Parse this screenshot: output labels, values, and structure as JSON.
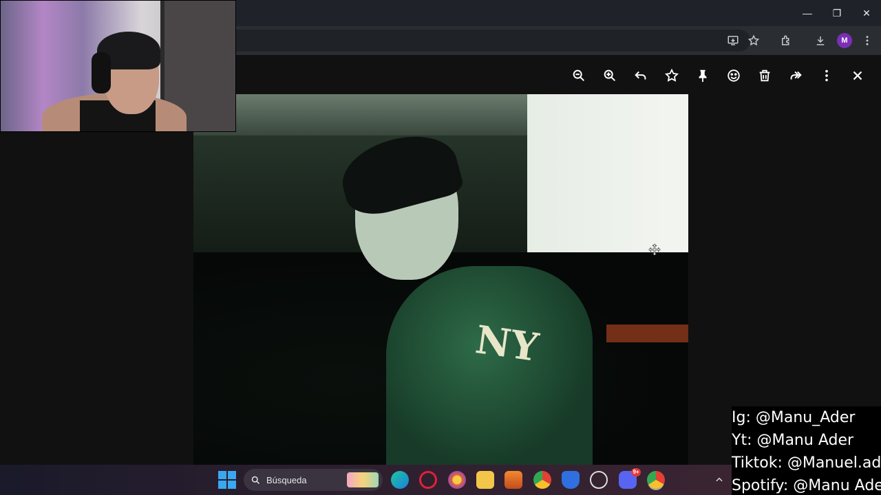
{
  "window_controls": {
    "minimize": "—",
    "maximize": "❐",
    "close": "✕"
  },
  "browser": {
    "profile_initial": "M"
  },
  "viewer": {
    "toolbar_icons": [
      "zoom-out-icon",
      "zoom-in-icon",
      "reply-icon",
      "star-icon",
      "pin-icon",
      "emoji-icon",
      "delete-icon",
      "forward-icon",
      "more-icon",
      "close-icon"
    ]
  },
  "photo": {
    "jacket_logo": "NY"
  },
  "social": {
    "lines": [
      "Ig: @Manu_Ader",
      "Yt: @Manu Ader",
      "Tiktok: @Manuel.ader",
      "Spotify: @Manu Ader"
    ]
  },
  "taskbar": {
    "search_placeholder": "Búsqueda",
    "discord_badge": "9+",
    "colors": {
      "accent": "#3aa7f0",
      "badge": "#e23a3a"
    }
  }
}
